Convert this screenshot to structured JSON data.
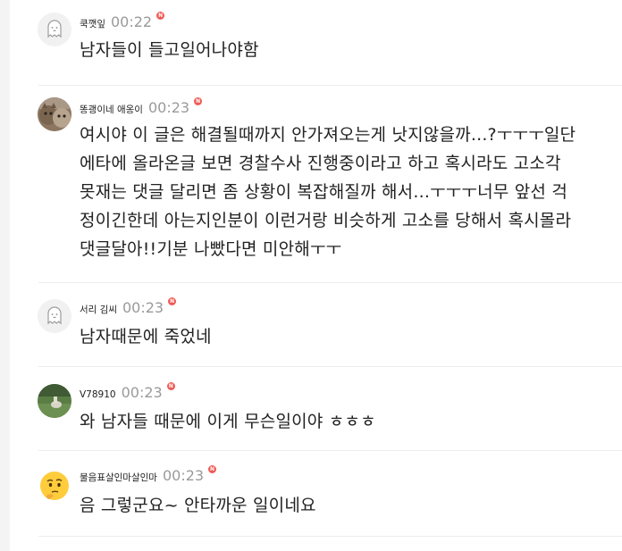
{
  "comments": [
    {
      "nickname": "쿡깻잎",
      "time": "00:22",
      "badge": "N",
      "avatar_icon": "ghost-avatar-icon",
      "text_lines": [
        "남자들이 들고일어나야함"
      ]
    },
    {
      "nickname": "똥괭이네 애옹이",
      "time": "00:23",
      "badge": "N",
      "avatar_icon": "cats-photo-avatar",
      "text_lines": [
        "여시야 이 글은 해결될때까지 안가져오는게 낫지않을까...?ㅜㅜㅜ일단",
        "에타에 올라온글 보면 경찰수사 진행중이라고 하고 혹시라도 고소각",
        "못재는 댓글 달리면 좀 상황이 복잡해질까 해서...ㅜㅜㅜ너무 앞선 걱",
        "정이긴한데 아는지인분이 이런거랑 비슷하게 고소를 당해서 혹시몰라",
        "댓글달아!!기분 나빴다면 미안해ㅜㅜ"
      ]
    },
    {
      "nickname": "서리 김씨",
      "time": "00:23",
      "badge": "N",
      "avatar_icon": "ghost-avatar-icon",
      "text_lines": [
        "남자때문에 죽었네"
      ]
    },
    {
      "nickname": "V78910",
      "time": "00:23",
      "badge": "N",
      "avatar_icon": "field-photo-avatar",
      "text_lines": [
        "와 남자들 때문에 이게 무슨일이야 ㅎㅎㅎ"
      ]
    },
    {
      "nickname": "물음표살인마살인마",
      "time": "00:23",
      "badge": "N",
      "avatar_icon": "thinking-face-emoji-avatar",
      "text_lines": [
        "음 그렇군요~ 안타까운 일이네요"
      ]
    }
  ]
}
